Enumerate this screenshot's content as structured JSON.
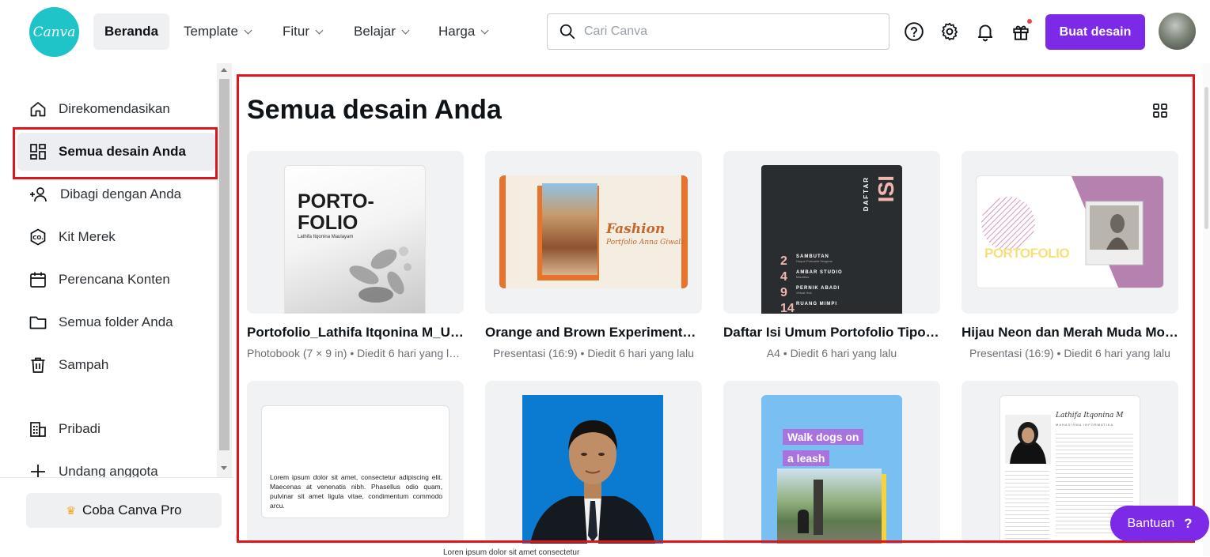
{
  "header": {
    "logo_text": "Canva",
    "nav": [
      {
        "label": "Beranda",
        "active": true
      },
      {
        "label": "Template"
      },
      {
        "label": "Fitur"
      },
      {
        "label": "Belajar"
      },
      {
        "label": "Harga"
      }
    ],
    "search_placeholder": "Cari Canva",
    "icons": [
      "help-icon",
      "gear-icon",
      "bell-icon",
      "gift-icon"
    ],
    "create_label": "Buat desain",
    "accent": "#7d2ae8"
  },
  "sidebar": {
    "items": [
      {
        "label": "Direkomendasikan",
        "icon": "home-icon"
      },
      {
        "label": "Semua desain Anda",
        "icon": "grid-icon",
        "active": true
      },
      {
        "label": "Dibagi dengan Anda",
        "icon": "people-icon"
      },
      {
        "label": "Kit Merek",
        "icon": "brand-kit-icon"
      },
      {
        "label": "Perencana Konten",
        "icon": "calendar-icon"
      },
      {
        "label": "Semua folder Anda",
        "icon": "folder-icon"
      },
      {
        "label": "Sampah",
        "icon": "trash-icon"
      },
      {
        "label": "Pribadi",
        "icon": "building-icon"
      },
      {
        "label": "Undang anggota",
        "icon": "plus-icon"
      }
    ],
    "trial_label": "Coba Canva Pro"
  },
  "main": {
    "title": "Semua desain Anda",
    "designs": [
      {
        "title": "Portofolio_Lathifa Itqonina M_UI a...",
        "meta": "Photobook (7 × 9 in) • Diedit 6 hari yang la...",
        "thumb": {
          "heading": "PORTO-\nFOLIO",
          "sub": "Lathifa Itqonina Maulayam"
        }
      },
      {
        "title": "Orange and Brown Experimental F...",
        "meta": "Presentasi (16:9) • Diedit 6 hari yang lalu",
        "thumb": {
          "heading": "Fashion",
          "sub": "Portfolio Anna Giwalz"
        }
      },
      {
        "title": "Daftar Isi Umum Portofolio Tipogr...",
        "meta": "A4 • Diedit 6 hari yang lalu",
        "thumb": {
          "heading": "ISI",
          "vertical": "DAFTAR",
          "rows": [
            {
              "num": "2",
              "name": "SAMBUTAN",
              "sub": "Hoque Portoaria Sesgens"
            },
            {
              "num": "4",
              "name": "AMBAR STUDIO",
              "sub": "Mauritius"
            },
            {
              "num": "9",
              "name": "PERNIK ABADI",
              "sub": "Virtual Hub"
            },
            {
              "num": "14",
              "name": "RUANG MIMPI",
              "sub": ""
            }
          ]
        }
      },
      {
        "title": "Hijau Neon dan Merah Muda Mod...",
        "meta": "Presentasi (16:9) • Diedit 6 hari yang lalu",
        "thumb": {
          "heading": "PORTOFOLIO"
        }
      },
      {
        "title": "",
        "meta": "",
        "thumb": {
          "body": "Lorem ipsum dolor sit amet, consectetur adipiscing elit. Maecenas at venenatis nibh. Phasellus odio quam, pulvinar sit amet ligula vitae, condimentum commodo arcu."
        }
      },
      {
        "title": "",
        "meta": "",
        "thumb": {}
      },
      {
        "title": "",
        "meta": "",
        "thumb": {
          "heading": "Walk dogs on",
          "heading2": "a leash"
        }
      },
      {
        "title": "",
        "meta": "",
        "thumb": {
          "name": "Lathifa Itqonina M",
          "role": "MAHASISWA INFORMATIKA"
        }
      }
    ]
  },
  "help_label": "Bantuan",
  "help_q": "?",
  "bottom_fragment": "Loren ipsum dolor sit amet consectetur"
}
